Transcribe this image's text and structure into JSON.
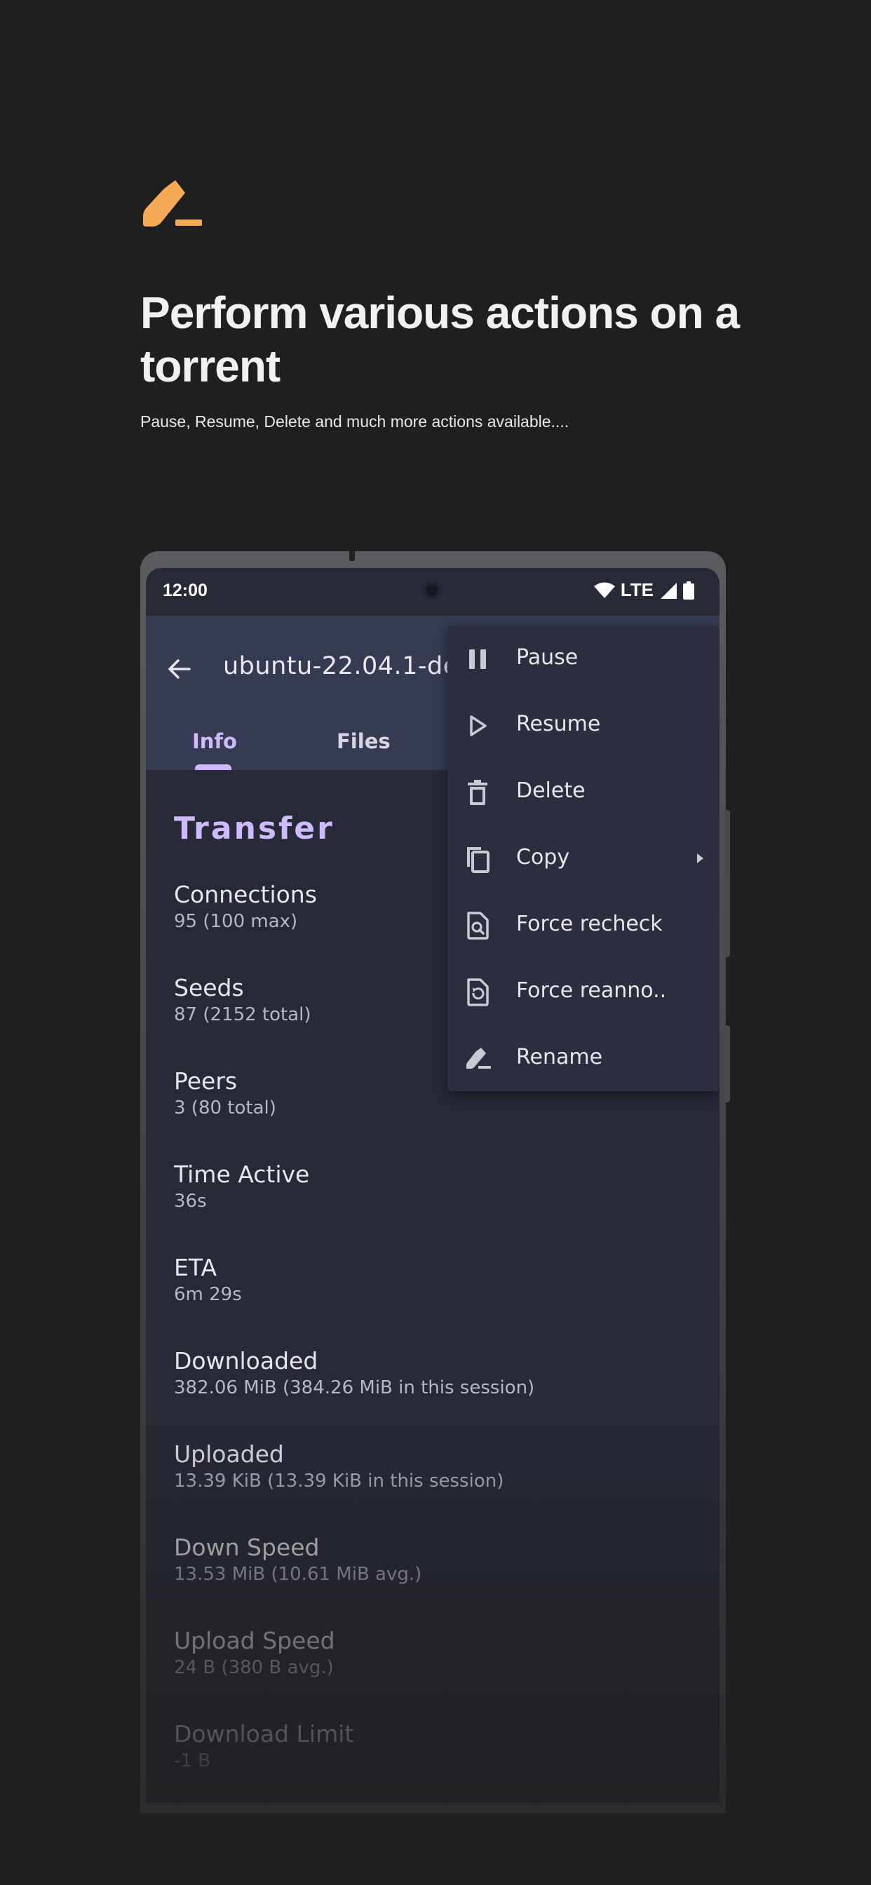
{
  "promo": {
    "icon": "rename-pencil-icon",
    "accent_color": "#f6aa55",
    "headline": "Perform various actions on a torrent",
    "subline": "Pause, Resume, Delete and much more actions available...."
  },
  "status_bar": {
    "time": "12:00",
    "network": "LTE",
    "icons": [
      "wifi-icon",
      "signal-icon",
      "battery-icon"
    ]
  },
  "app_bar": {
    "back_icon": "arrow-back-icon",
    "title": "ubuntu-22.04.1-de",
    "tabs": [
      {
        "label": "Info",
        "selected": true
      },
      {
        "label": "Files",
        "selected": false
      }
    ],
    "background": "#363a52",
    "accent": "#cfb9ff"
  },
  "transfer": {
    "section_title": "Transfer",
    "items": [
      {
        "label": "Connections",
        "value": "95 (100 max)"
      },
      {
        "label": "Seeds",
        "value": "87 (2152 total)"
      },
      {
        "label": "Peers",
        "value": "3 (80 total)"
      },
      {
        "label": "Time Active",
        "value": "36s"
      },
      {
        "label": "ETA",
        "value": "6m 29s"
      },
      {
        "label": "Downloaded",
        "value": "382.06 MiB (384.26 MiB in this session)"
      },
      {
        "label": "Uploaded",
        "value": "13.39 KiB (13.39 KiB in this session)"
      },
      {
        "label": "Down Speed",
        "value": "13.53 MiB (10.61 MiB avg.)"
      },
      {
        "label": "Upload Speed",
        "value": "24 B (380 B avg.)"
      },
      {
        "label": "Download Limit",
        "value": "-1 B"
      }
    ]
  },
  "menu": {
    "items": [
      {
        "label": "Pause",
        "icon": "pause-icon"
      },
      {
        "label": "Resume",
        "icon": "play-icon"
      },
      {
        "label": "Delete",
        "icon": "trash-icon"
      },
      {
        "label": "Copy",
        "icon": "copy-icon",
        "has_submenu": true
      },
      {
        "label": "Force recheck",
        "icon": "file-search-icon"
      },
      {
        "label": "Force reanno..",
        "icon": "file-refresh-icon"
      },
      {
        "label": "Rename",
        "icon": "rename-icon"
      }
    ]
  }
}
